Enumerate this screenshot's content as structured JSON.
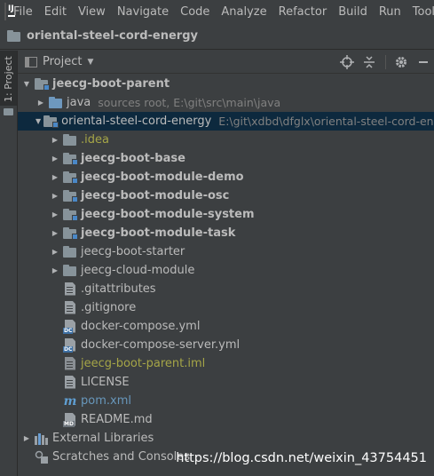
{
  "menu": {
    "items": [
      "File",
      "Edit",
      "View",
      "Navigate",
      "Code",
      "Analyze",
      "Refactor",
      "Build",
      "Run",
      "Tools"
    ]
  },
  "navbar": {
    "title": "oriental-steel-cord-energy"
  },
  "left_strip": {
    "tab_label": "1: Project"
  },
  "panel": {
    "title": "Project"
  },
  "tree": {
    "root": {
      "label": "jeecg-boot-parent"
    },
    "java": {
      "label": "java",
      "hint": "sources root,  E:\\git\\src\\main\\java"
    },
    "project": {
      "label": "oriental-steel-cord-energy",
      "hint": "E:\\git\\xdbd\\dfglx\\oriental-steel-cord-energy"
    },
    "idea": {
      "label": ".idea"
    },
    "modules": [
      {
        "label": "jeecg-boot-base"
      },
      {
        "label": "jeecg-boot-module-demo"
      },
      {
        "label": "jeecg-boot-module-osc"
      },
      {
        "label": "jeecg-boot-module-system"
      },
      {
        "label": "jeecg-boot-module-task"
      }
    ],
    "folders": [
      {
        "label": "jeecg-boot-starter"
      },
      {
        "label": "jeecg-cloud-module"
      }
    ],
    "files": {
      "gitattributes": ".gitattributes",
      "gitignore": ".gitignore",
      "compose": "docker-compose.yml",
      "compose_server": "docker-compose-server.yml",
      "iml": "jeecg-boot-parent.iml",
      "license": "LICENSE",
      "pom": "pom.xml",
      "readme": "README.md"
    },
    "external": {
      "label": "External Libraries"
    },
    "scratches": {
      "label": "Scratches and Consoles"
    }
  },
  "watermark": "https://blog.csdn.net/weixin_43754451",
  "colors": {
    "background": "#3c3f41",
    "selection": "#0d293e",
    "text": "#bbbbbb",
    "ignored": "#a5a547",
    "maven": "#6897bb"
  }
}
